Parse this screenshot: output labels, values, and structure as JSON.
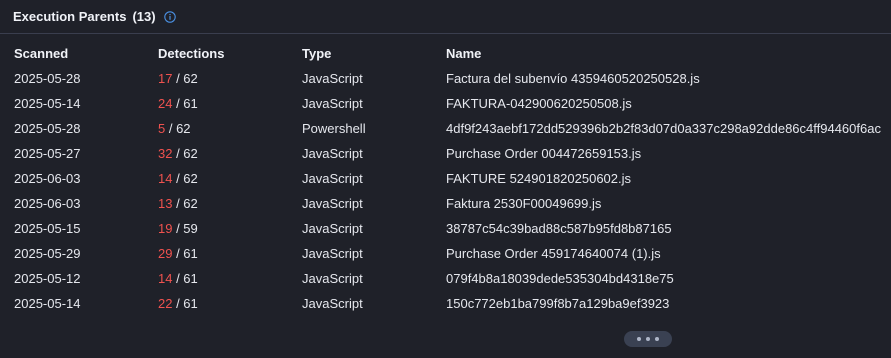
{
  "header": {
    "title": "Execution Parents",
    "count": "(13)",
    "info_icon": "info-circle-icon",
    "accent": "#4a90e2"
  },
  "columns": {
    "scanned": "Scanned",
    "detections": "Detections",
    "type": "Type",
    "name": "Name"
  },
  "colors": {
    "background": "#1f2129",
    "detection_positive": "#f0524f"
  },
  "rows": [
    {
      "scanned": "2025-05-28",
      "positives": "17",
      "total": " / 62",
      "type": "JavaScript",
      "name": "Factura del subenvío 4359460520250528.js"
    },
    {
      "scanned": "2025-05-14",
      "positives": "24",
      "total": " / 61",
      "type": "JavaScript",
      "name": "FAKTURA-042900620250508.js"
    },
    {
      "scanned": "2025-05-28",
      "positives": "5",
      "total": " / 62",
      "type": "Powershell",
      "name": "4df9f243aebf172dd529396b2b2f83d07d0a337c298a92dde86c4ff94460f6ac"
    },
    {
      "scanned": "2025-05-27",
      "positives": "32",
      "total": " / 62",
      "type": "JavaScript",
      "name": "Purchase Order 004472659153.js"
    },
    {
      "scanned": "2025-06-03",
      "positives": "14",
      "total": " / 62",
      "type": "JavaScript",
      "name": "FAKTURE 524901820250602.js"
    },
    {
      "scanned": "2025-06-03",
      "positives": "13",
      "total": " / 62",
      "type": "JavaScript",
      "name": "Faktura 2530F00049699.js"
    },
    {
      "scanned": "2025-05-15",
      "positives": "19",
      "total": " / 59",
      "type": "JavaScript",
      "name": "38787c54c39bad88c587b95fd8b87165"
    },
    {
      "scanned": "2025-05-29",
      "positives": "29",
      "total": " / 61",
      "type": "JavaScript",
      "name": "Purchase Order 459174640074 (1).js"
    },
    {
      "scanned": "2025-05-12",
      "positives": "14",
      "total": " / 61",
      "type": "JavaScript",
      "name": "079f4b8a18039dede535304bd4318e75"
    },
    {
      "scanned": "2025-05-14",
      "positives": "22",
      "total": " / 61",
      "type": "JavaScript",
      "name": "150c772eb1ba799f8b7a129ba9ef3923"
    }
  ],
  "pager": {
    "icon": "more-horizontal-icon"
  }
}
